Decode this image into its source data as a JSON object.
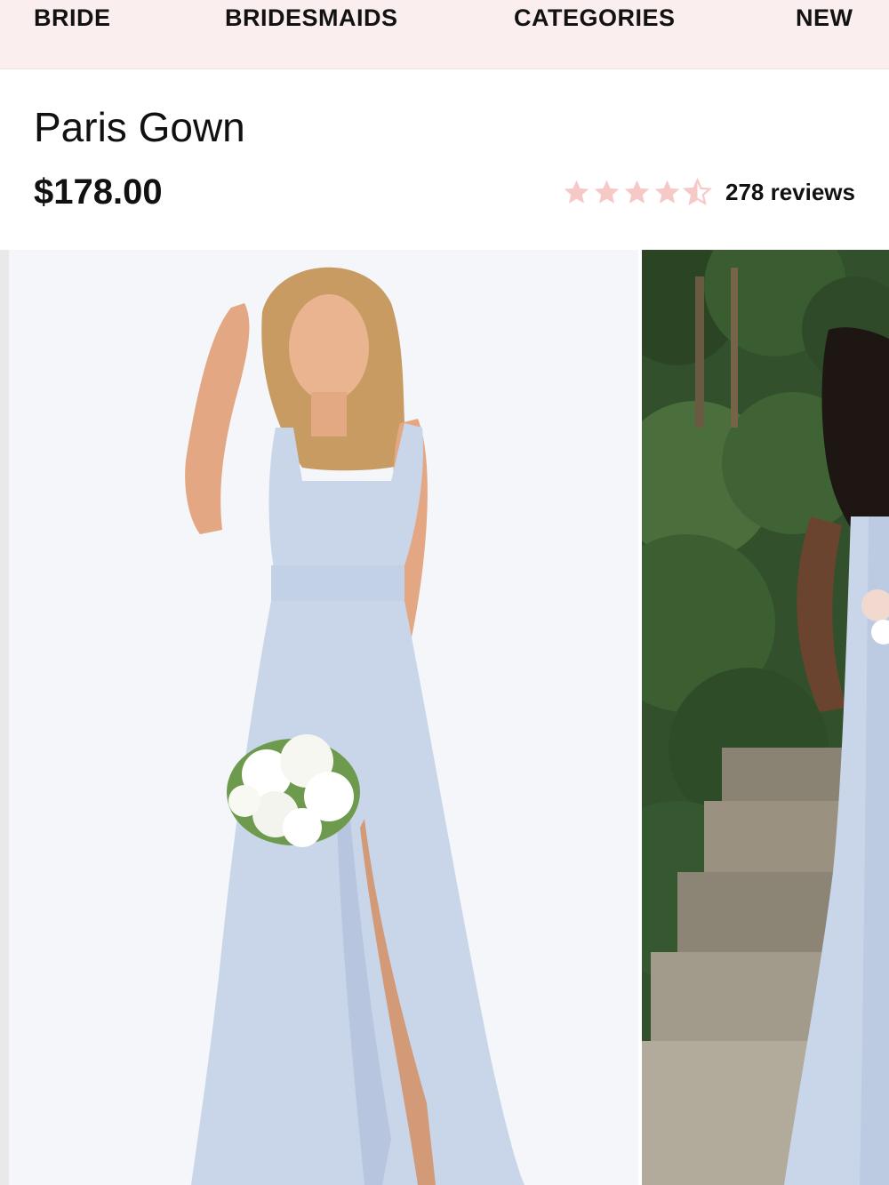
{
  "nav": {
    "items": [
      {
        "label": "BRIDE"
      },
      {
        "label": "BRIDESMAIDS"
      },
      {
        "label": "CATEGORIES"
      },
      {
        "label": "NEW"
      }
    ]
  },
  "product": {
    "title": "Paris Gown",
    "price": "$178.00",
    "rating": {
      "value": 4.5,
      "max": 5,
      "reviews_label": "278 reviews",
      "star_color": "#f6c9c6"
    }
  },
  "gallery": {
    "images": [
      {
        "alt": "Model in light blue square neck gown holding white bouquet"
      },
      {
        "alt": "Model in light blue gown outdoors by garden steps"
      }
    ]
  },
  "colors": {
    "nav_bg": "#fbeeee",
    "dress_blue": "#c9d6ea"
  }
}
